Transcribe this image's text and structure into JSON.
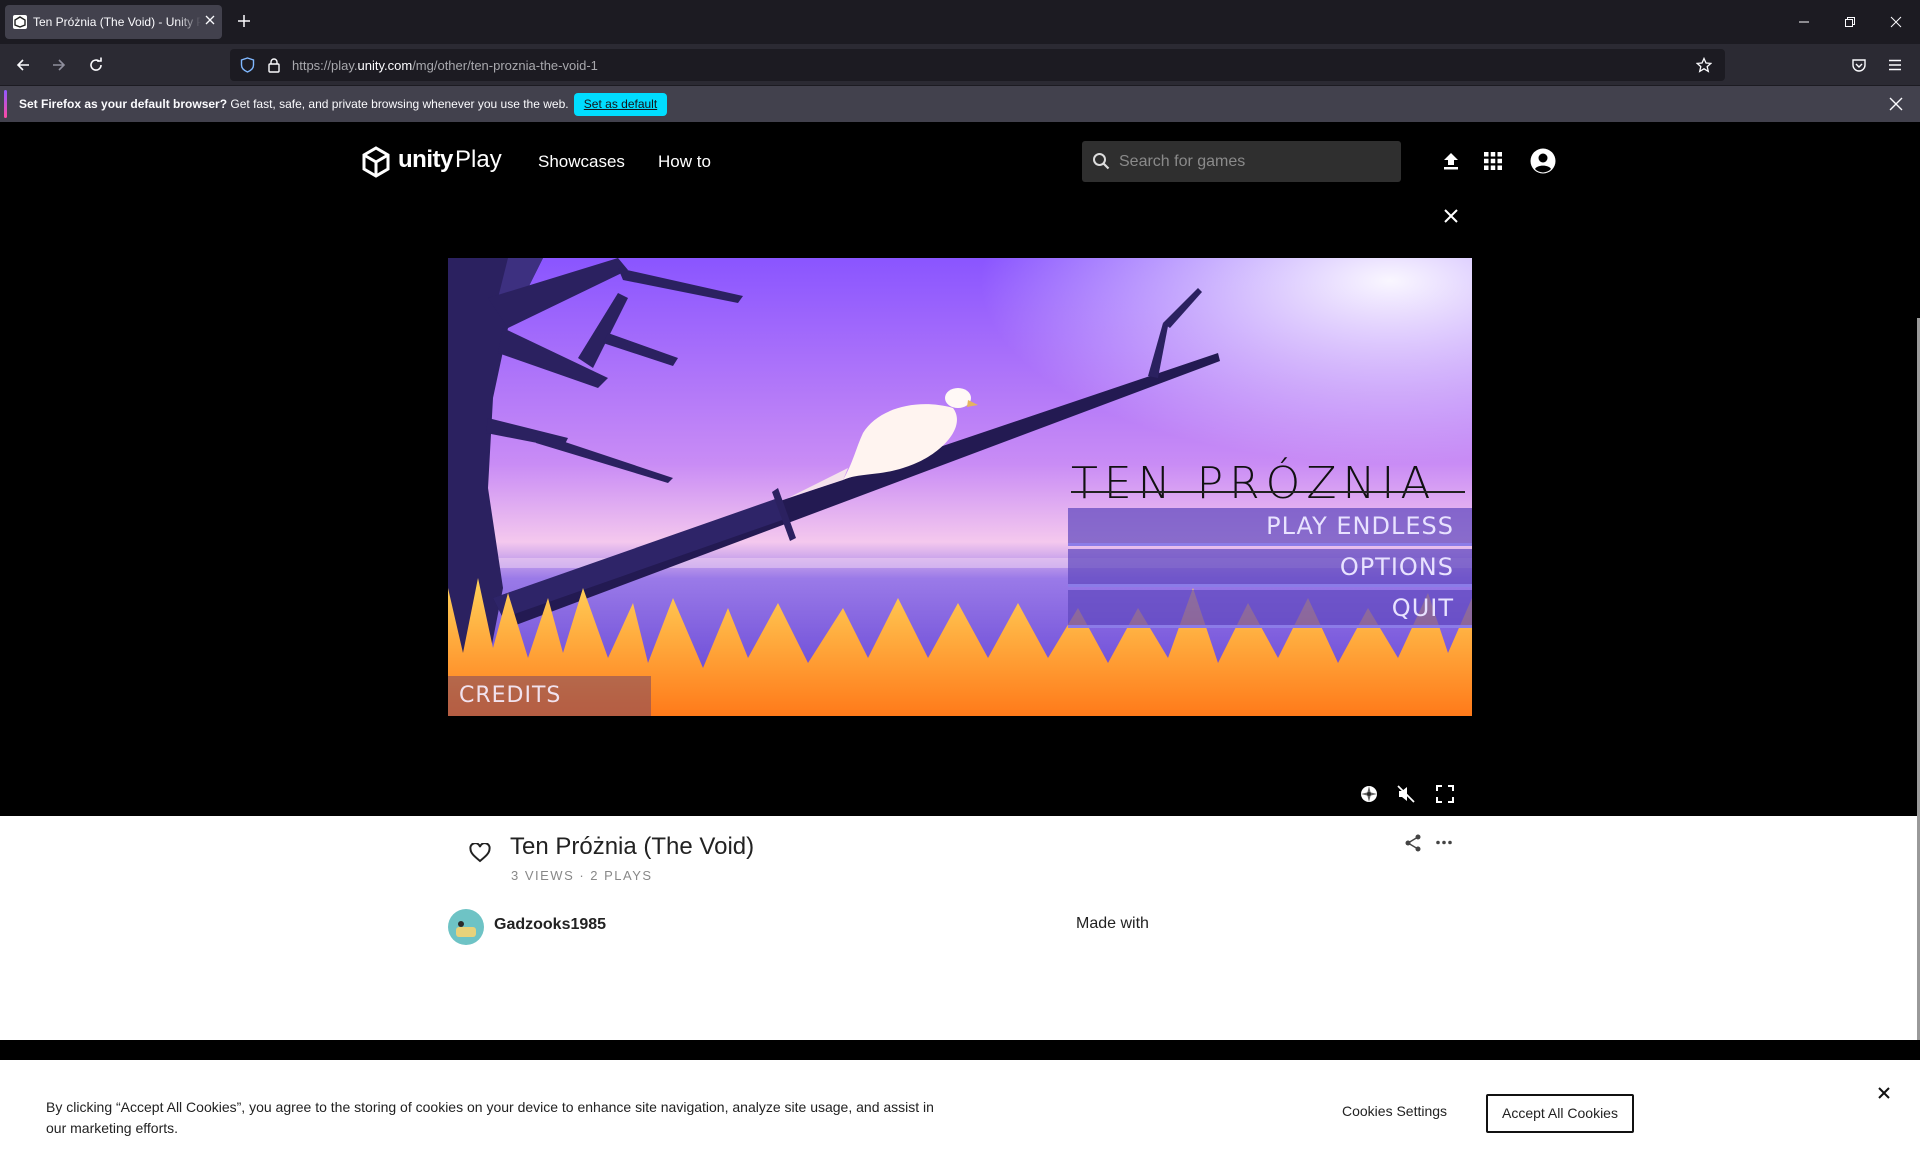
{
  "browser": {
    "tab_title": "Ten Próżnia (The Void) - Unity Play",
    "url_prefix": "https://play.",
    "url_domain": "unity.com",
    "url_path": "/mg/other/ten-proznia-the-void-1",
    "notification": {
      "bold": "Set Firefox as your default browser?",
      "text": " Get fast, safe, and private browsing whenever you use the web.",
      "button": "Set as default"
    }
  },
  "site": {
    "logo_text_bold": "unity",
    "logo_text": "Play",
    "nav": [
      "Showcases",
      "How to"
    ],
    "search_placeholder": "Search for games"
  },
  "game": {
    "title_text": "TEN PRÓZNIA",
    "menu": [
      "PLAY ENDLESS",
      "OPTIONS",
      "QUIT"
    ],
    "credits": "CREDITS"
  },
  "info": {
    "name": "Ten Próżnia (The Void)",
    "stats": "3 VIEWS · 2 PLAYS",
    "author": "Gadzooks1985",
    "made_with": "Made with"
  },
  "cookie": {
    "text": "By clicking “Accept All Cookies”, you agree to the storing of cookies on your device to enhance site navigation, analyze site usage, and assist in our marketing efforts.",
    "settings": "Cookies Settings",
    "accept": "Accept All Cookies"
  },
  "colors": {
    "accent_cyan": "#00ddff",
    "sky_top": "#8a55ff",
    "grass": "#ff9a2a"
  }
}
